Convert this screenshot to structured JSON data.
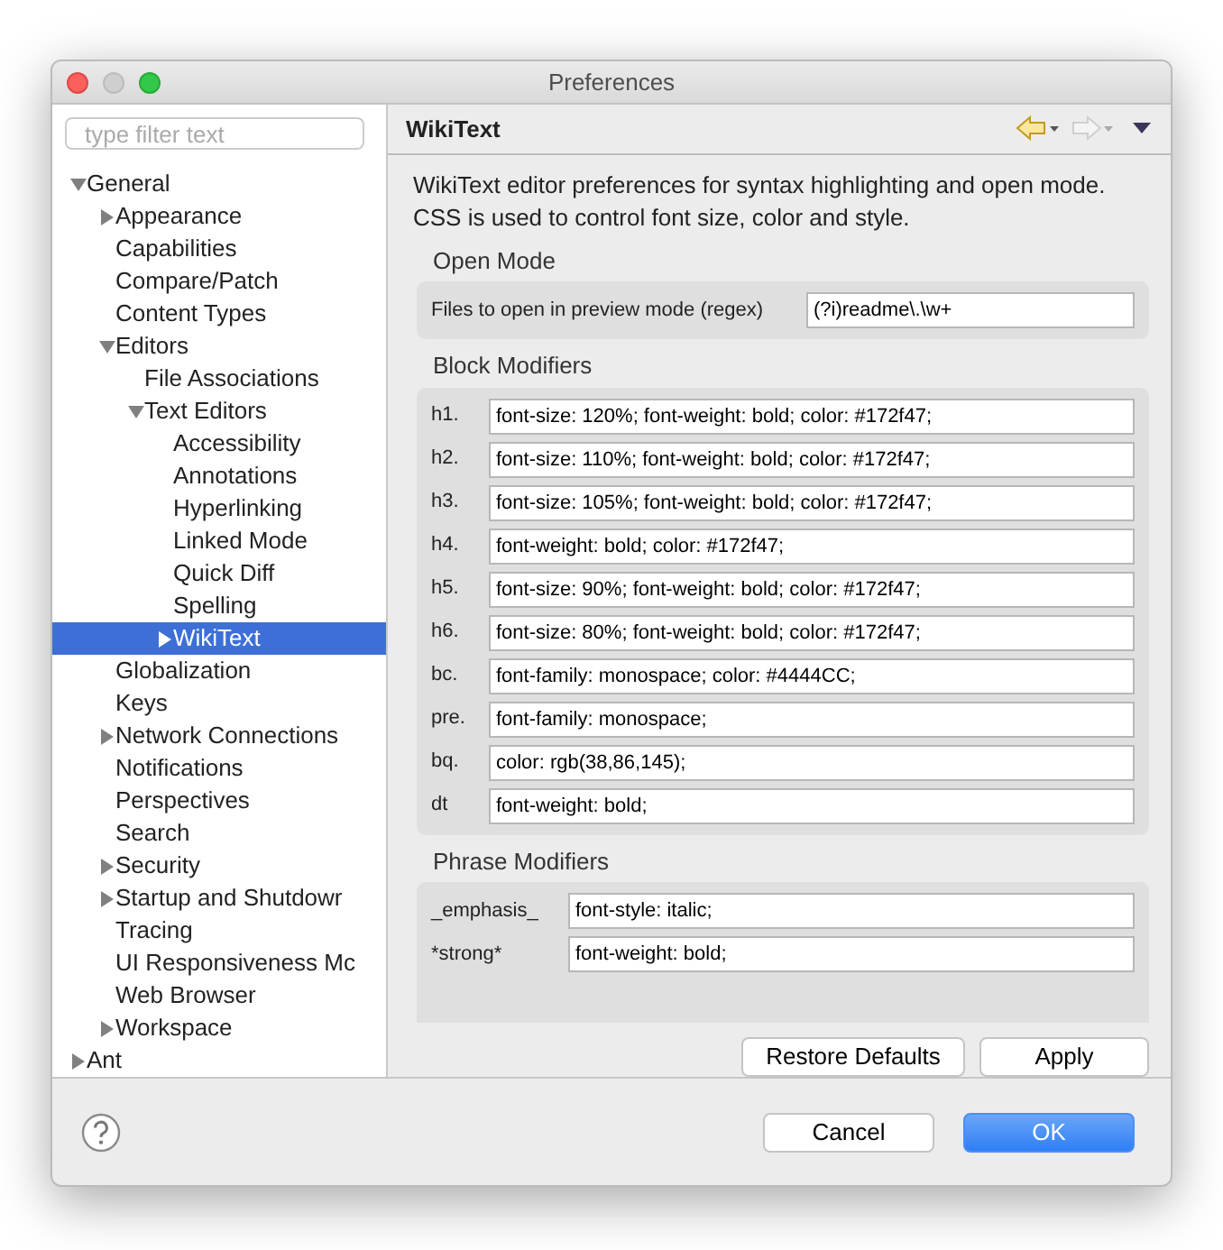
{
  "window": {
    "title": "Preferences"
  },
  "filter": {
    "placeholder": "type filter text"
  },
  "tree": [
    {
      "label": "General",
      "expanded": true,
      "selected": false,
      "children": [
        {
          "label": "Appearance",
          "expanded": false,
          "selected": false
        },
        {
          "label": "Capabilities",
          "selected": false
        },
        {
          "label": "Compare/Patch",
          "selected": false
        },
        {
          "label": "Content Types",
          "selected": false
        },
        {
          "label": "Editors",
          "expanded": true,
          "selected": false,
          "children": [
            {
              "label": "File Associations",
              "selected": false
            },
            {
              "label": "Text Editors",
              "expanded": true,
              "selected": false,
              "children": [
                {
                  "label": "Accessibility",
                  "selected": false
                },
                {
                  "label": "Annotations",
                  "selected": false
                },
                {
                  "label": "Hyperlinking",
                  "selected": false
                },
                {
                  "label": "Linked Mode",
                  "selected": false
                },
                {
                  "label": "Quick Diff",
                  "selected": false
                },
                {
                  "label": "Spelling",
                  "selected": false
                },
                {
                  "label": "WikiText",
                  "expanded": false,
                  "selected": true
                }
              ]
            }
          ]
        },
        {
          "label": "Globalization",
          "selected": false
        },
        {
          "label": "Keys",
          "selected": false
        },
        {
          "label": "Network Connections",
          "expanded": false,
          "selected": false
        },
        {
          "label": "Notifications",
          "selected": false
        },
        {
          "label": "Perspectives",
          "selected": false
        },
        {
          "label": "Search",
          "selected": false
        },
        {
          "label": "Security",
          "expanded": false,
          "selected": false
        },
        {
          "label": "Startup and Shutdowr",
          "expanded": false,
          "selected": false
        },
        {
          "label": "Tracing",
          "selected": false
        },
        {
          "label": "UI Responsiveness Mc",
          "selected": false
        },
        {
          "label": "Web Browser",
          "selected": false
        },
        {
          "label": "Workspace",
          "expanded": false,
          "selected": false
        }
      ]
    },
    {
      "label": "Ant",
      "expanded": false,
      "selected": false
    }
  ],
  "page": {
    "title": "WikiText",
    "description": "WikiText editor preferences for syntax highlighting and open mode. CSS is used to control font size, color and style.",
    "open_mode": {
      "heading": "Open Mode",
      "label": "Files to open in preview mode (regex)",
      "value": "(?i)readme\\.\\w+"
    },
    "block_modifiers": {
      "heading": "Block Modifiers",
      "rows": [
        {
          "label": "h1.",
          "value": "font-size: 120%; font-weight: bold; color: #172f47;"
        },
        {
          "label": "h2.",
          "value": "font-size: 110%; font-weight: bold; color: #172f47;"
        },
        {
          "label": "h3.",
          "value": "font-size: 105%; font-weight: bold; color: #172f47;"
        },
        {
          "label": "h4.",
          "value": "font-weight: bold; color: #172f47;"
        },
        {
          "label": "h5.",
          "value": "font-size: 90%; font-weight: bold; color: #172f47;"
        },
        {
          "label": "h6.",
          "value": "font-size: 80%; font-weight: bold; color: #172f47;"
        },
        {
          "label": "bc.",
          "value": "font-family: monospace; color: #4444CC;"
        },
        {
          "label": "pre.",
          "value": "font-family: monospace;"
        },
        {
          "label": "bq.",
          "value": "color: rgb(38,86,145);"
        },
        {
          "label": "dt",
          "value": "font-weight: bold;"
        }
      ]
    },
    "phrase_modifiers": {
      "heading": "Phrase Modifiers",
      "rows": [
        {
          "label": "_emphasis_",
          "value": "font-style: italic;"
        },
        {
          "label": "*strong*",
          "value": "font-weight: bold;"
        }
      ]
    },
    "buttons": [
      {
        "label": "Restore Defaults"
      },
      {
        "label": "Apply"
      }
    ]
  },
  "footer_buttons": [
    {
      "label": "Cancel",
      "kind": "secondary"
    },
    {
      "label": "OK",
      "kind": "primary"
    }
  ]
}
